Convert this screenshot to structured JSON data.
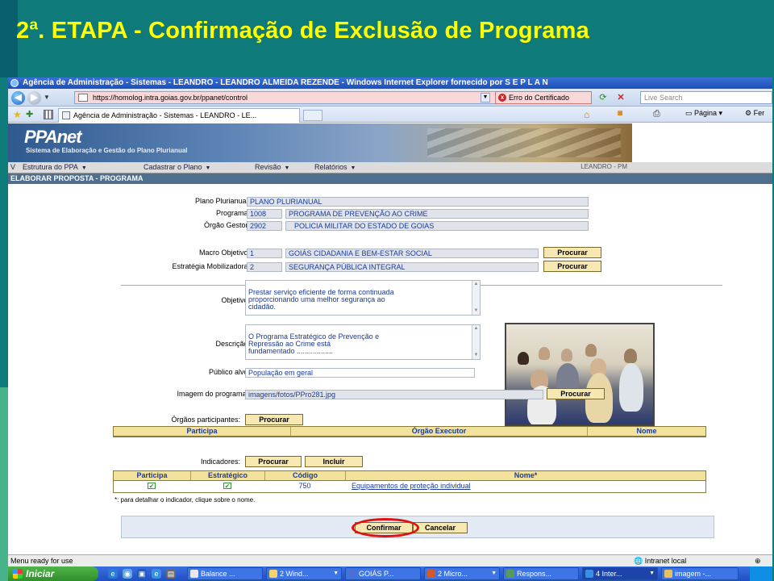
{
  "slide": {
    "title": "2ª. ETAPA - Confirmação de Exclusão de Programa"
  },
  "browser": {
    "window_title": "Agência de Administração - Sistemas - LEANDRO - LEANDRO ALMEIDA REZENDE - Windows Internet Explorer fornecido por S E P L A N",
    "address_url": "https://homolog.intra.goias.gov.br/ppanet/control",
    "cert_error": "Erro do Certificado",
    "search_placeholder": "Live Search",
    "tab_title": "Agência de Administração - Sistemas - LEANDRO - LE...",
    "cmd_page": "Página",
    "cmd_tools": "Fer",
    "status_text": "Menu ready for use",
    "status_zone": "Intranet local"
  },
  "app": {
    "logo": "PPAnet",
    "subtitle": "Sistema de Elaboração e Gestão do Plano Plurianual",
    "menu": [
      "Estrutura do PPA",
      "Cadastrar o Plano",
      "Revisão",
      "Relatórios"
    ],
    "menu_prefix": "V",
    "user_label": "LEANDRO - PM",
    "page_title": "ELABORAR PROPOSTA - PROGRAMA"
  },
  "form": {
    "plano_label": "Plano Plurianual:",
    "plano_value": "PLANO PLURIANUAL",
    "programa_label": "Programa:",
    "programa_code": "1008",
    "programa_name": "PROGRAMA DE PREVENÇÃO AO CRIME",
    "orgao_label": "Órgão Gestor:",
    "orgao_code": "2902",
    "orgao_name": "POLICIA MILITAR DO ESTADO DE GOIAS",
    "macro_label": "Macro Objetivo:",
    "macro_code": "1",
    "macro_name": "GOIÁS CIDADANIA E BEM-ESTAR SOCIAL",
    "estrategia_label": "Estratégia Mobilizadora:",
    "estrategia_code": "2",
    "estrategia_name": "SEGURANÇA PÚBLICA INTEGRAL",
    "objetivo_label": "Objetivo:",
    "objetivo_text": "Prestar serviço eficiente de forma continuada\nproporcionando uma melhor segurança ao\ncidadão.",
    "descricao_label": "Descrição:",
    "descricao_text": "O Programa Estratégico de Prevenção e\nRepressão ao Crime está\nfundamentado ..................",
    "publico_label": "Público alvo:",
    "publico_value": "População em geral",
    "imagem_label": "Imagem do programa:",
    "imagem_value": "imagens/fotos/PPro281.jpg",
    "orgaos_label": "Órgãos participantes:",
    "indicadores_label": "Indicadores:",
    "procurar": "Procurar",
    "incluir": "Incluir",
    "note": "*: para detalhar o indicador, clique sobre o nome.",
    "confirmar": "Confirmar",
    "cancelar": "Cancelar"
  },
  "orgaos_table": {
    "headers": [
      "Participa",
      "Órgão Executor",
      "Nome"
    ]
  },
  "indicadores_table": {
    "headers": [
      "Participa",
      "Estratégico",
      "Código",
      "Nome*"
    ],
    "rows": [
      {
        "participa": "✔",
        "estrategico": "✔",
        "codigo": "750",
        "nome": "Equipamentos de proteção individual"
      }
    ]
  },
  "taskbar": {
    "start": "Iniciar",
    "items": [
      "Balance ...",
      "2 Wind...",
      "GOIÁS P...",
      "2 Micro...",
      "Respons...",
      "4 Inter...",
      "imagem -..."
    ]
  }
}
